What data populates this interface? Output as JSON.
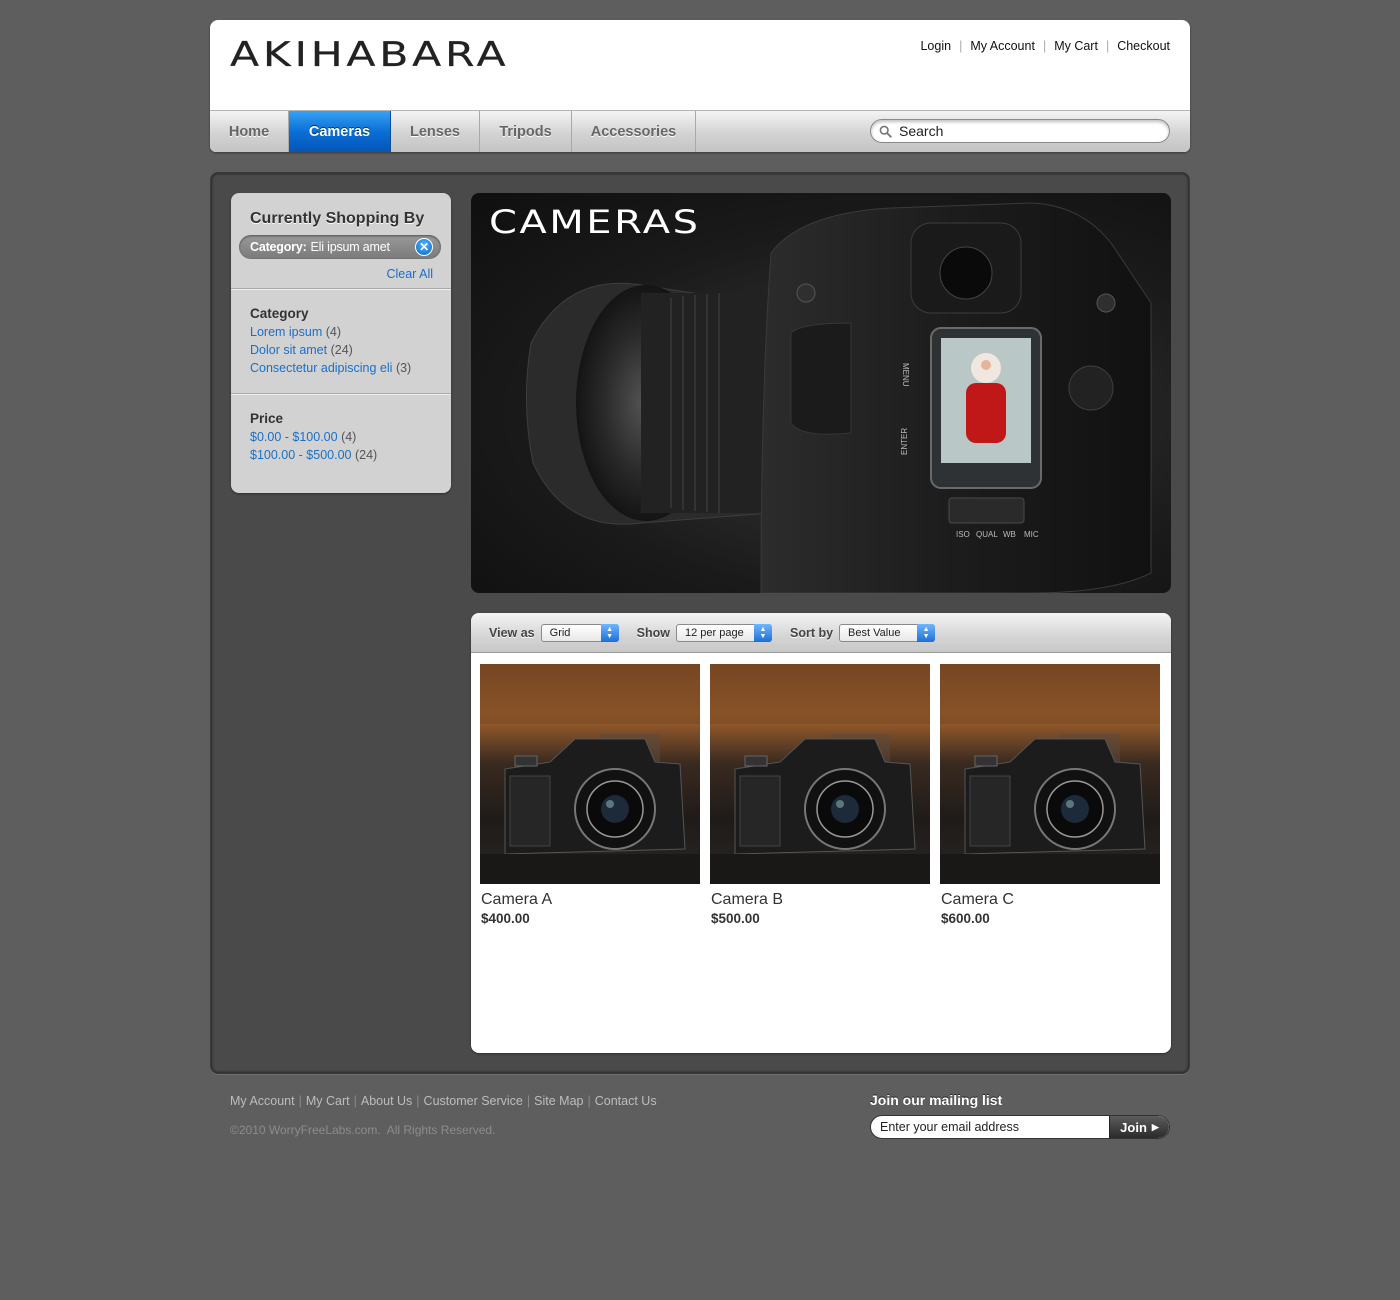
{
  "brand": {
    "logo": "AKIHABARA"
  },
  "toplinks": [
    {
      "label": "Login"
    },
    {
      "label": "My Account"
    },
    {
      "label": "My Cart"
    },
    {
      "label": "Checkout"
    }
  ],
  "nav": {
    "items": [
      {
        "label": "Home"
      },
      {
        "label": "Cameras"
      },
      {
        "label": "Lenses"
      },
      {
        "label": "Tripods"
      },
      {
        "label": "Accessories"
      }
    ],
    "active": "Cameras"
  },
  "search": {
    "placeholder": "Search"
  },
  "sidebar": {
    "title": "Currently Shopping By",
    "filter": {
      "key": "Category:",
      "value": "Eli ipsum amet"
    },
    "clear_all": "Clear All",
    "category": {
      "heading": "Category",
      "items": [
        {
          "label": "Lorem ipsum",
          "count": "(4)"
        },
        {
          "label": "Dolor sit amet",
          "count": "(24)"
        },
        {
          "label": "Consectetur adipiscing eli",
          "count": "(3)"
        }
      ]
    },
    "price": {
      "heading": "Price",
      "items": [
        {
          "label": "$0.00 - $100.00",
          "count": "(4)"
        },
        {
          "label": "$100.00 - $500.00",
          "count": "(24)"
        }
      ]
    }
  },
  "banner": {
    "title": "CAMERAS",
    "camera_labels": [
      "MENU",
      "ENTER",
      "ISO",
      "QUAL",
      "WB",
      "MIC"
    ]
  },
  "toolbar": {
    "view_label": "View as",
    "view_value": "Grid",
    "show_label": "Show",
    "show_value": "12 per page",
    "sort_label": "Sort by",
    "sort_value": "Best Value"
  },
  "products": [
    {
      "name": "Camera A",
      "price": "$400.00"
    },
    {
      "name": "Camera B",
      "price": "$500.00"
    },
    {
      "name": "Camera C",
      "price": "$600.00"
    }
  ],
  "footer": {
    "links": [
      {
        "label": "My Account"
      },
      {
        "label": "My Cart"
      },
      {
        "label": "About Us"
      },
      {
        "label": "Customer Service"
      },
      {
        "label": "Site Map"
      },
      {
        "label": "Contact Us"
      }
    ],
    "copyright": "©2010 WorryFreeLabs.com.  All Rights Reserved.",
    "mailing_title": "Join our mailing list",
    "email_placeholder": "Enter your email address",
    "join_label": "Join"
  }
}
